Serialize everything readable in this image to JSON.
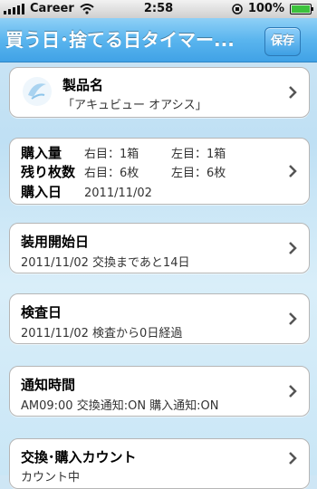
{
  "status_bar": {
    "carrier": "Career",
    "time": "2:58",
    "battery": "100%"
  },
  "navbar": {
    "title": "買う日･捨てる日タイマー...",
    "save_label": "保存"
  },
  "product": {
    "title": "製品名",
    "value": "「アキュビュー オアシス」",
    "icon": "lens-icon"
  },
  "purchase": {
    "rows": [
      {
        "label": "購入量",
        "right": "右目：1箱",
        "left": "左目：1箱"
      },
      {
        "label": "残り枚数",
        "right": "右目：6枚",
        "left": "左目：6枚"
      },
      {
        "label": "購入日",
        "right": "2011/11/02",
        "left": ""
      }
    ]
  },
  "start_date": {
    "title": "装用開始日",
    "value": "2011/11/02  交換まであと14日"
  },
  "exam_date": {
    "title": "検査日",
    "value": "2011/11/02  検査から0日経過"
  },
  "notify": {
    "title": "通知時間",
    "value": "AM09:00  交換通知:ON  購入通知:ON"
  },
  "count": {
    "title": "交換･購入カウント",
    "value": "カウント中"
  },
  "colors": {
    "nav_blue": "#4aa8e8",
    "background": "#cfe6f5"
  }
}
